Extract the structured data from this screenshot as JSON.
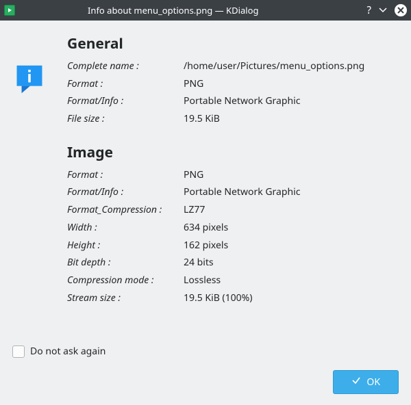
{
  "titlebar": {
    "title": "Info about menu_options.png — KDialog"
  },
  "sections": {
    "general": {
      "heading": "General",
      "rows": [
        {
          "label": "Complete name :",
          "value": "/home/user/Pictures/menu_options.png"
        },
        {
          "label": "Format :",
          "value": "PNG"
        },
        {
          "label": "Format/Info :",
          "value": "Portable Network Graphic"
        },
        {
          "label": "File size :",
          "value": "19.5 KiB"
        }
      ]
    },
    "image": {
      "heading": "Image",
      "rows": [
        {
          "label": "Format :",
          "value": "PNG"
        },
        {
          "label": "Format/Info :",
          "value": "Portable Network Graphic"
        },
        {
          "label": "Format_Compression :",
          "value": "LZ77"
        },
        {
          "label": "Width :",
          "value": "634 pixels"
        },
        {
          "label": "Height :",
          "value": "162 pixels"
        },
        {
          "label": "Bit depth :",
          "value": "24 bits"
        },
        {
          "label": "Compression mode :",
          "value": "Lossless"
        },
        {
          "label": "Stream size :",
          "value": "19.5 KiB (100%)"
        }
      ]
    }
  },
  "footer": {
    "checkbox_label": "Do not ask again",
    "ok_label": "OK"
  }
}
